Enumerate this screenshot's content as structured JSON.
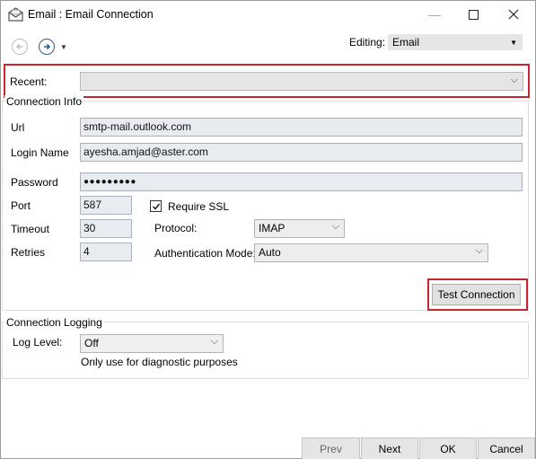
{
  "window": {
    "title": "Email : Email Connection",
    "minimize_glyph": "—",
    "maximize_glyph": "☐",
    "close_glyph": "✕"
  },
  "toolbar": {
    "back_icon": "arrow-left-circle-icon",
    "forward_icon": "arrow-right-circle-icon",
    "editing_label": "Editing:",
    "editing_value": "Email"
  },
  "recent": {
    "label": "Recent:",
    "value": ""
  },
  "connection_info": {
    "title": "Connection Info",
    "url_label": "Url",
    "url_value": "smtp-mail.outlook.com",
    "login_label": "Login Name",
    "login_value": "ayesha.amjad@aster.com",
    "password_label": "Password",
    "password_value": "●●●●●●●●●",
    "port_label": "Port",
    "port_value": "587",
    "require_ssl_label": "Require SSL",
    "require_ssl_checked": true,
    "timeout_label": "Timeout",
    "timeout_value": "30",
    "protocol_label": "Protocol:",
    "protocol_value": "IMAP",
    "retries_label": "Retries",
    "retries_value": "4",
    "auth_label": "Authentication Mode:",
    "auth_value": "Auto",
    "test_button": "Test Connection"
  },
  "logging": {
    "title": "Connection Logging",
    "log_level_label": "Log Level:",
    "log_level_value": "Off",
    "hint": "Only use for diagnostic purposes"
  },
  "footer": {
    "prev": "Prev",
    "next": "Next",
    "ok": "OK",
    "cancel": "Cancel"
  },
  "colors": {
    "highlight": "#c9252d",
    "input_bg": "#e8ecf1",
    "nav_forward": "#2d5c8f"
  }
}
